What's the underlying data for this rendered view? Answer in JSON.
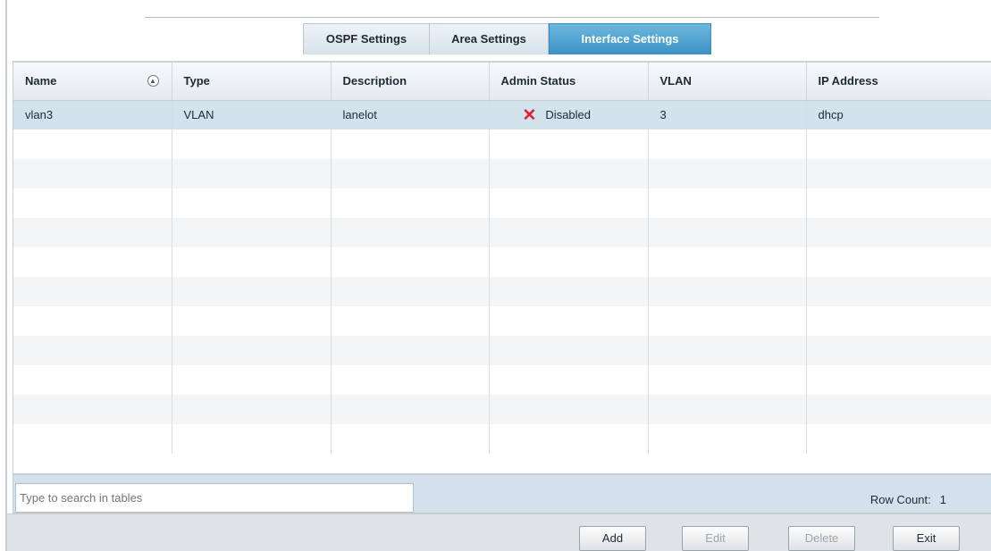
{
  "tabs": [
    {
      "label": "OSPF Settings",
      "active": false
    },
    {
      "label": "Area Settings",
      "active": false
    },
    {
      "label": "Interface Settings",
      "active": true
    }
  ],
  "table": {
    "columns": [
      "Name",
      "Type",
      "Description",
      "Admin Status",
      "VLAN",
      "IP Address"
    ],
    "rows": [
      {
        "name": "vlan3",
        "type": "VLAN",
        "description": "lanelot",
        "admin_status": "Disabled",
        "admin_status_icon": "x-icon",
        "vlan": "3",
        "ip_address": "dhcp"
      }
    ]
  },
  "search": {
    "placeholder": "Type to search in tables",
    "value": ""
  },
  "row_count": {
    "label": "Row Count:",
    "value": "1"
  },
  "buttons": {
    "add": "Add",
    "edit": "Edit",
    "delete": "Delete",
    "exit": "Exit"
  },
  "colors": {
    "accent": "#3b92c6",
    "selected_row": "#d3e3ed",
    "disabled_icon": "#e0212d"
  }
}
